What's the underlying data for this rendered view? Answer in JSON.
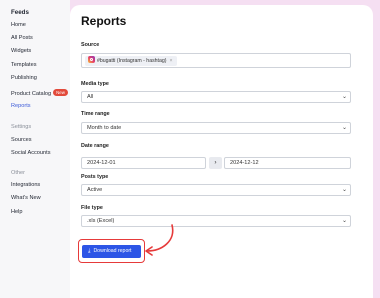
{
  "sidebar": {
    "title": "Feeds",
    "items": [
      {
        "label": "Home"
      },
      {
        "label": "All Posts"
      },
      {
        "label": "Widgets"
      },
      {
        "label": "Templates"
      },
      {
        "label": "Publishing"
      },
      {
        "label": "Product Catalog",
        "badge": "New"
      },
      {
        "label": "Reports",
        "active": true
      }
    ],
    "settings_header": "Settings",
    "settings_items": [
      {
        "label": "Sources"
      },
      {
        "label": "Social Accounts"
      }
    ],
    "other_header": "Other",
    "other_items": [
      {
        "label": "Integrations"
      },
      {
        "label": "What's New"
      },
      {
        "label": "Help"
      }
    ]
  },
  "main": {
    "title": "Reports",
    "source": {
      "label": "Source",
      "chip": "#bugatti (Instagram - hashtag)",
      "chip_remove": "×"
    },
    "media_type": {
      "label": "Media type",
      "value": "All"
    },
    "time_range": {
      "label": "Time range",
      "value": "Month to date"
    },
    "date_range": {
      "label": "Date range",
      "from": "2024-12-01",
      "arrow": "›",
      "to": "2024-12-12"
    },
    "posts_type": {
      "label": "Posts type",
      "value": "Active"
    },
    "file_type": {
      "label": "File type",
      "value": ".xls (Excel)"
    },
    "download_label": "Download report"
  },
  "icons": {
    "source_chip": "instagram-icon",
    "select_arrow": "chevron-down-icon",
    "download": "download-icon",
    "annotation": "curved-arrow"
  },
  "colors": {
    "accent": "#2c55e6",
    "active_nav": "#3c5bd8",
    "badge": "#e24a3b",
    "annotation": "#e63a3a",
    "background": "#f5dff2"
  }
}
